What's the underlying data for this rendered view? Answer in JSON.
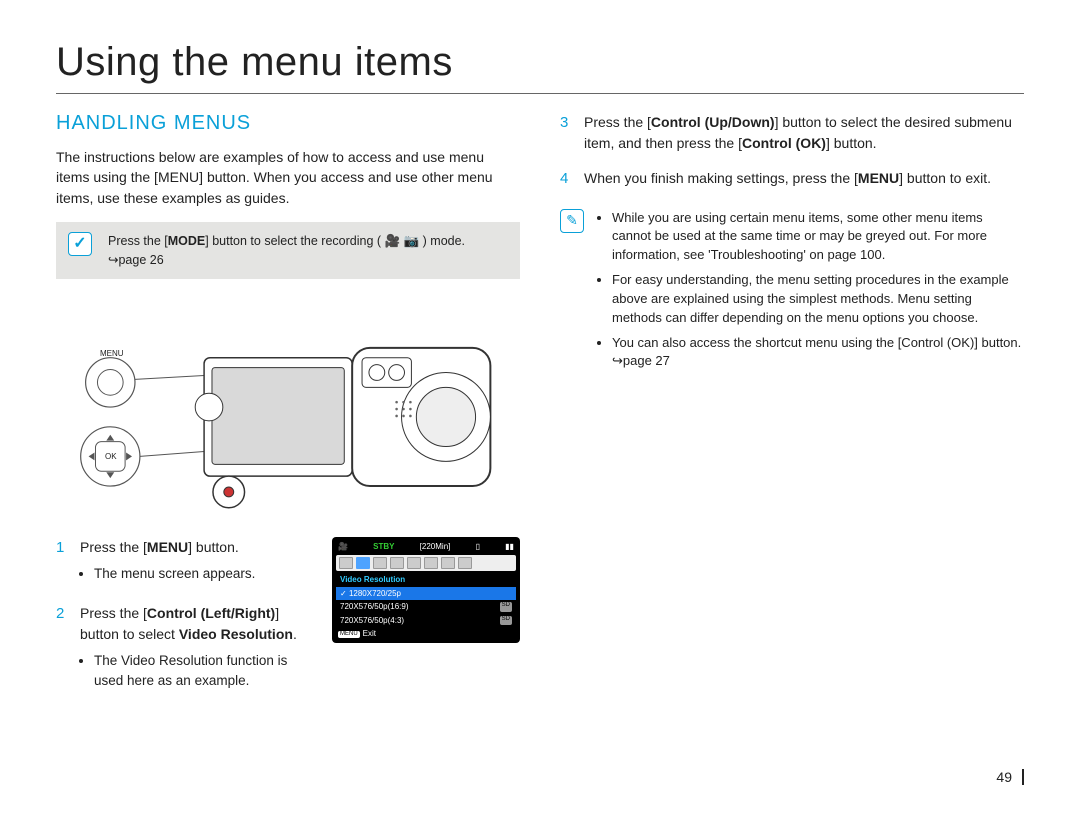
{
  "title": "Using the menu items",
  "section_head": "HANDLING MENUS",
  "intro": "The instructions below are examples of how to access and use menu items using the [MENU] button. When you access and use other menu items, use these examples as guides.",
  "mode_tip": {
    "prefix": "Press the [",
    "mode": "MODE",
    "suffix": "] button to select the recording (",
    "closing": ") mode.",
    "pageref": "↪page 26"
  },
  "camera_labels": {
    "menu": "MENU",
    "ok": "OK"
  },
  "steps_left": [
    {
      "num": "1",
      "text_parts": [
        "Press the [",
        "MENU",
        "] button."
      ],
      "sub": [
        "The menu screen appears."
      ]
    },
    {
      "num": "2",
      "text_parts": [
        "Press the [",
        "Control (Left/Right)",
        "] button to select ",
        "Video Resolution",
        "."
      ],
      "sub": [
        "The Video Resolution function is used here as an example."
      ]
    }
  ],
  "steps_right": [
    {
      "num": "3",
      "text_parts": [
        "Press the [",
        "Control (Up/Down)",
        "] button to select the desired submenu item, and then press the [",
        "Control (OK)",
        "] button."
      ]
    },
    {
      "num": "4",
      "text_parts": [
        "When you finish making settings, press the [",
        "MENU",
        "] button to exit."
      ]
    }
  ],
  "notes": [
    "While you are using certain menu items, some other menu items cannot be used at the same time or may be greyed out. For more information, see 'Troubleshooting' on page 100.",
    "For easy understanding, the menu setting procedures in the example above are explained using the simplest methods. Menu setting methods can differ depending on the menu options you choose.",
    "You can also access the shortcut menu using the [Control (OK)] button. ↪page 27"
  ],
  "lcd": {
    "stby": "STBY",
    "time": "[220Min]",
    "menu_header": "Video Resolution",
    "rows": [
      {
        "label": "1280X720/25p",
        "selected": true,
        "sd": false
      },
      {
        "label": "720X576/50p(16:9)",
        "selected": false,
        "sd": true
      },
      {
        "label": "720X576/50p(4:3)",
        "selected": false,
        "sd": true
      }
    ],
    "exit_btn": "MENU",
    "exit_label": "Exit"
  },
  "page_number": "49"
}
